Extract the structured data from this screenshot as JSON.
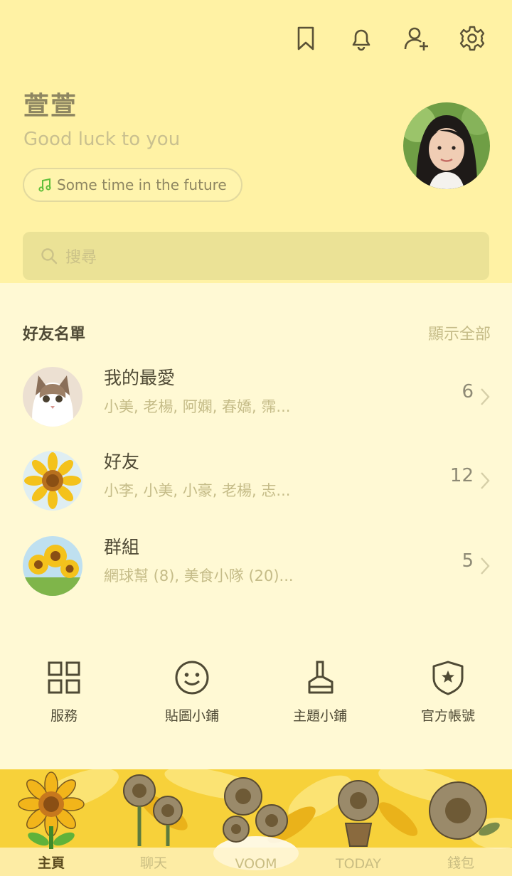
{
  "header": {
    "icons": [
      "bookmark-icon",
      "bell-icon",
      "add-friend-icon",
      "gear-icon"
    ]
  },
  "profile": {
    "name": "萱萱",
    "status": "Good luck to you",
    "music": "Some time in the future"
  },
  "search": {
    "placeholder": "搜尋"
  },
  "friends": {
    "title": "好友名單",
    "show_all": "顯示全部",
    "rows": [
      {
        "name": "我的最愛",
        "members": "小美, 老楊, 阿嫻, 春嬌, 霈...",
        "count": "6"
      },
      {
        "name": "好友",
        "members": "小李, 小美, 小豪, 老楊, 志...",
        "count": "12"
      },
      {
        "name": "群組",
        "members": "網球幫 (8), 美食小隊 (20)...",
        "count": "5"
      }
    ]
  },
  "services": [
    {
      "label": "服務",
      "icon": "grid-icon"
    },
    {
      "label": "貼圖小鋪",
      "icon": "smiley-icon"
    },
    {
      "label": "主題小鋪",
      "icon": "paint-brush-icon"
    },
    {
      "label": "官方帳號",
      "icon": "shield-star-icon"
    }
  ],
  "tabs": [
    {
      "label": "主頁",
      "active": true
    },
    {
      "label": "聊天"
    },
    {
      "label": "VOOM"
    },
    {
      "label": "TODAY"
    },
    {
      "label": "錢包"
    }
  ],
  "colors": {
    "header_bg": "#fff2a4",
    "body_bg": "#fff9d4",
    "accent_text": "#c5bc88",
    "dark_text": "#4f4a35"
  }
}
